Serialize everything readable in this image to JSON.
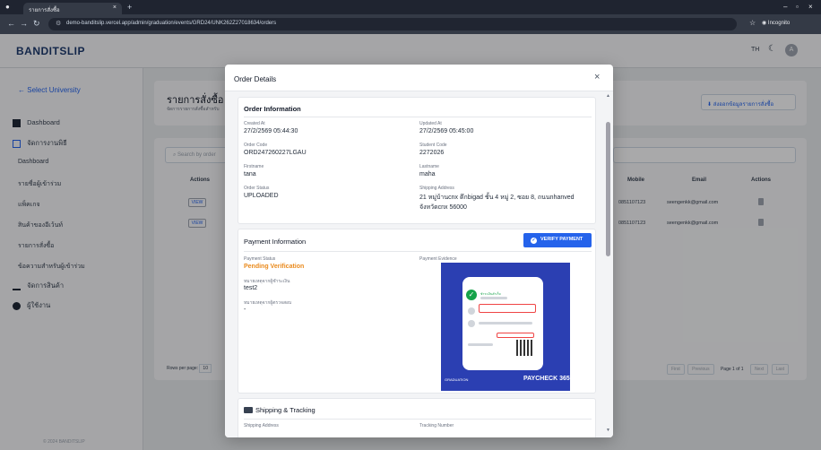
{
  "browser": {
    "tab_title": "รายการสั่งซื้อ",
    "tab_close": "×",
    "new_tab": "+",
    "url": "demo-banditslip.vercel.app/admin/graduation/events/GRD24/UNK262Z27018634/orders",
    "incognito": "Incognito"
  },
  "header": {
    "brand": "BANDITSLIP",
    "lang": "TH",
    "avatar_letter": "A"
  },
  "sidebar": {
    "back": "Select University",
    "dashboard": "Dashboard",
    "events_group": "จัดการงานพิธี",
    "sub_items": [
      "Dashboard",
      "รายชื่อผู้เข้าร่วม",
      "แพ็คเกจ",
      "สินค้าของอีเว้นท์",
      "รายการสั่งซื้อ",
      "ข้อความสำหรับผู้เข้าร่วม"
    ],
    "products": "จัดการสินค้า",
    "users": "ผู้ใช้งาน",
    "copyright": "© 2024 BANDITSLIP"
  },
  "page": {
    "title": "รายการสั่งซื้อ",
    "subtitle": "จัดการรายการสั่งซื้อสำหรับ",
    "export_label": "ส่งออกข้อมูลรายการสั่งซื้อ",
    "search_placeholder": "Search by order",
    "columns": {
      "actions": "Actions",
      "mobile": "Mobile",
      "email": "Email",
      "actions2": "Actions"
    },
    "rows": [
      {
        "view": "VIEW",
        "mobile": "0851107123",
        "email": "seengenkk@gmail.com"
      },
      {
        "view": "VIEW",
        "mobile": "0851107123",
        "email": "seengenkk@gmail.com"
      }
    ],
    "rows_per_page_label": "Rows per page:",
    "rows_per_page": "10",
    "pager": {
      "first": "First",
      "prev": "Previous",
      "page": "Page 1 of 1",
      "next": "Next",
      "last": "Last"
    }
  },
  "modal": {
    "title": "Order Details",
    "close": "×",
    "order_info": {
      "title": "Order Information",
      "created_at_label": "Created At",
      "created_at": "27/2/2569 05:44:30",
      "updated_at_label": "Updated At",
      "updated_at": "27/2/2569 05:45:00",
      "order_code_label": "Order Code",
      "order_code": "ORD247260227LGAU",
      "student_code_label": "Student Code",
      "student_code": "2272026",
      "firstname_label": "Firstname",
      "firstname": "tana",
      "lastname_label": "Lastname",
      "lastname": "maha",
      "order_status_label": "Order Status",
      "order_status": "UPLOADED",
      "shipping_address_label": "Shipping Address",
      "shipping_address_1": "21 หมู่บ้านcnx ตึกbigad ชั้น 4 หมู่ 2, ซอย 8, ถนนnhanved",
      "shipping_address_2": "จังหวัดcnx 56000"
    },
    "payment_info": {
      "title": "Payment Information",
      "verify_label": "VERIFY PAYMENT",
      "payment_status_label": "Payment Status",
      "payment_status": "Pending Verification",
      "payment_evidence_label": "Payment Evidence",
      "payer_note_label": "หมายเหตุจากผู้ชำระเงิน",
      "payer_note": "test2",
      "admin_note_label": "หมายเหตุจากผู้ตรวจสอบ",
      "admin_note": "-",
      "evidence_brand": "PAYCHECK 365",
      "evidence_small": "GRADUATION",
      "evidence_title": "ชำระเงินสำเร็จ"
    },
    "shipping": {
      "title": "Shipping & Tracking",
      "address_label": "Shipping Address",
      "tracking_label": "Tracking Number"
    }
  }
}
